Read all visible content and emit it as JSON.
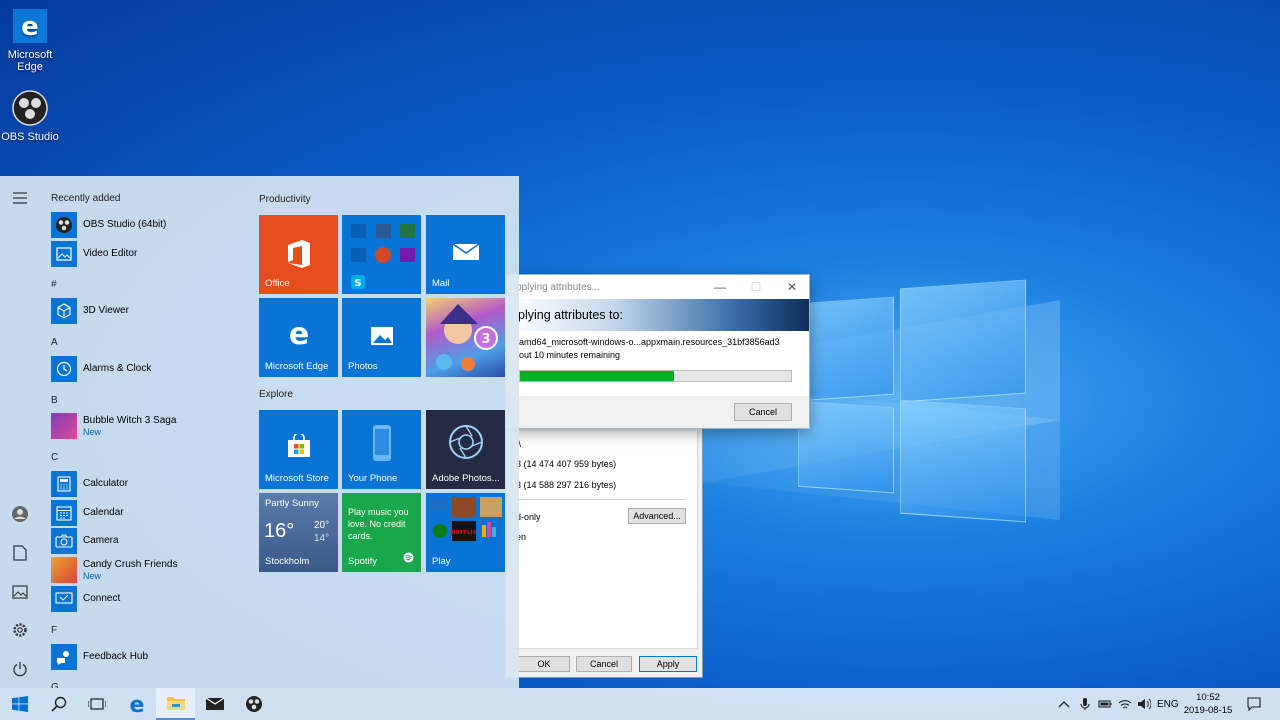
{
  "desktop": {
    "icons": [
      {
        "label": "Microsoft\nEdge",
        "icon": "edge-icon"
      },
      {
        "label": "OBS Studio",
        "icon": "obs-icon"
      }
    ]
  },
  "start_menu": {
    "recently_added_header": "Recently added",
    "recent": [
      {
        "label": "OBS Studio (64bit)",
        "icon": "obs-icon"
      },
      {
        "label": "Video Editor",
        "icon": "photo-icon"
      }
    ],
    "sections": [
      {
        "letter": "#",
        "apps": [
          {
            "label": "3D Viewer",
            "icon": "cube-icon"
          }
        ]
      },
      {
        "letter": "A",
        "apps": [
          {
            "label": "Alarms & Clock",
            "icon": "clock-icon"
          }
        ]
      },
      {
        "letter": "B",
        "apps": [
          {
            "label": "Bubble Witch 3 Saga",
            "badge": "New",
            "icon": "game-icon"
          }
        ]
      },
      {
        "letter": "C",
        "apps": [
          {
            "label": "Calculator",
            "icon": "calculator-icon"
          },
          {
            "label": "Calendar",
            "icon": "calendar-icon"
          },
          {
            "label": "Camera",
            "icon": "camera-icon"
          },
          {
            "label": "Candy Crush Friends",
            "badge": "New",
            "icon": "game-icon"
          },
          {
            "label": "Connect",
            "icon": "connect-icon"
          }
        ]
      },
      {
        "letter": "F",
        "apps": [
          {
            "label": "Feedback Hub",
            "icon": "feedback-icon"
          }
        ]
      },
      {
        "letter": "G",
        "apps": []
      }
    ],
    "groups": [
      {
        "name": "Productivity"
      },
      {
        "name": "Explore"
      }
    ],
    "tiles": {
      "office": "Office",
      "mail": "Mail",
      "edge": "Microsoft Edge",
      "photos": "Photos",
      "store": "Microsoft Store",
      "phone": "Your Phone",
      "adobe": "Adobe Photos...",
      "weather_condition": "Partly Sunny",
      "weather_temp": "16°",
      "weather_high": "20°",
      "weather_low": "14°",
      "weather_city": "Stockholm",
      "spotify_text": "Play music you love. No credit cards.",
      "spotify": "Spotify",
      "play": "Play"
    }
  },
  "apply_dialog": {
    "title": "pplying attributes...",
    "heading": "plying attributes to:",
    "file": "amd64_microsoft-windows-o...appxmain.resources_31bf3856ad3",
    "remaining": "out 10 minutes remaining",
    "progress": 0.57,
    "cancel": "Cancel"
  },
  "props_dialog": {
    "path": ":\\",
    "size": "3 (14 474 407 959 bytes)",
    "size_on_disk": "3 (14 588 297 216 bytes)",
    "readonly": "d-only",
    "hidden": "en",
    "advanced": "Advanced...",
    "ok": "OK",
    "cancel": "Cancel",
    "apply": "Apply"
  },
  "taskbar": {
    "language": "ENG",
    "time": "10:52",
    "date": "2019-08-15"
  },
  "colors": {
    "tile_blue": "#0a74d6",
    "office_orange": "#e74c1c",
    "spotify_green": "#1aa64a",
    "progress_green": "#06b025"
  }
}
